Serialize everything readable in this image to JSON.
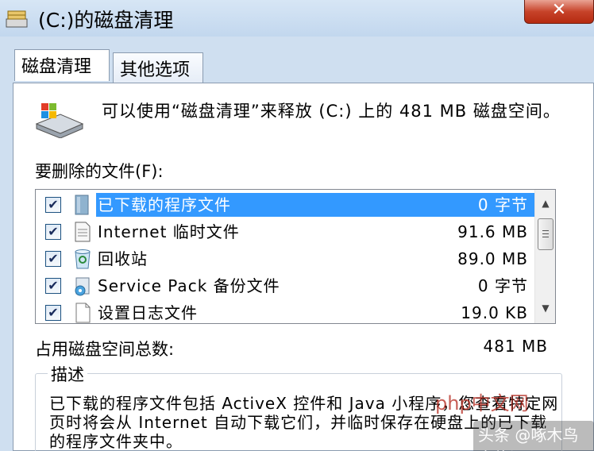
{
  "window": {
    "title": "(C:)的磁盘清理",
    "close_glyph": "✕"
  },
  "tabs": [
    {
      "label": "磁盘清理",
      "active": true
    },
    {
      "label": "其他选项",
      "active": false
    }
  ],
  "intro_text": "可以使用“磁盘清理”来释放  (C:) 上的 481 MB 磁盘空间。",
  "files_label": "要删除的文件(F):",
  "files": [
    {
      "name": "已下载的程序文件",
      "size": "0 字节",
      "checked": true,
      "selected": true,
      "icon": "folder-icon"
    },
    {
      "name": "Internet 临时文件",
      "size": "91.6 MB",
      "checked": true,
      "selected": false,
      "icon": "document-icon"
    },
    {
      "name": "回收站",
      "size": "89.0 MB",
      "checked": true,
      "selected": false,
      "icon": "recycle-bin-icon"
    },
    {
      "name": "Service Pack 备份文件",
      "size": "0 字节",
      "checked": true,
      "selected": false,
      "icon": "service-pack-icon"
    },
    {
      "name": "设置日志文件",
      "size": "19.0 KB",
      "checked": true,
      "selected": false,
      "icon": "blank-file-icon"
    }
  ],
  "checkmark_glyph": "✔",
  "scroll_up_glyph": "▲",
  "scroll_down_glyph": "▼",
  "total_label": "占用磁盘空间总数:",
  "total_value": "481 MB",
  "description": {
    "title": "描述",
    "text": "已下载的程序文件包括 ActiveX 控件和 Java 小程序，您查看特定网页时将会从 Internet 自动下载它们，并临时保存在硬盘上的已下载的程序文件夹中。"
  },
  "watermarks": {
    "php": "php中文网",
    "toutiao": "头条 @啄木鸟家修汇"
  },
  "colors": {
    "selection": "#3399ff",
    "titlebar": "#c2d7ee",
    "close_button": "#c7432a"
  }
}
